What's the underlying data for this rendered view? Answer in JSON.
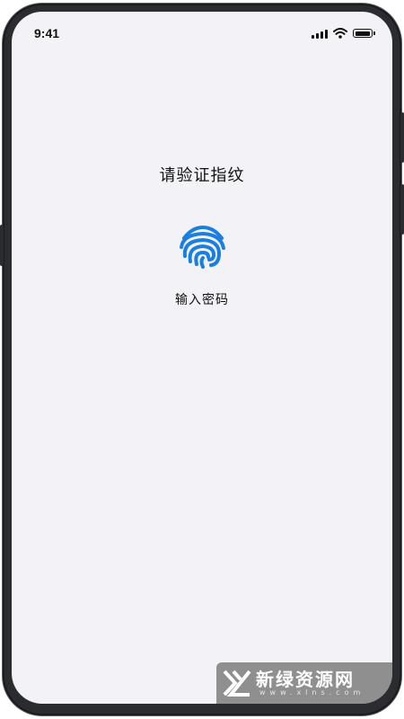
{
  "status_bar": {
    "time": "9:41"
  },
  "verify": {
    "title": "请验证指纹",
    "fingerprint_icon": "fingerprint-icon",
    "password_link": "输入密码"
  },
  "colors": {
    "accent": "#1a7fe0",
    "screen_bg": "#f3f3f7",
    "frame": "#2b2c30"
  },
  "watermark": {
    "text": "新绿资源网",
    "sub": "www.xlns.com"
  }
}
